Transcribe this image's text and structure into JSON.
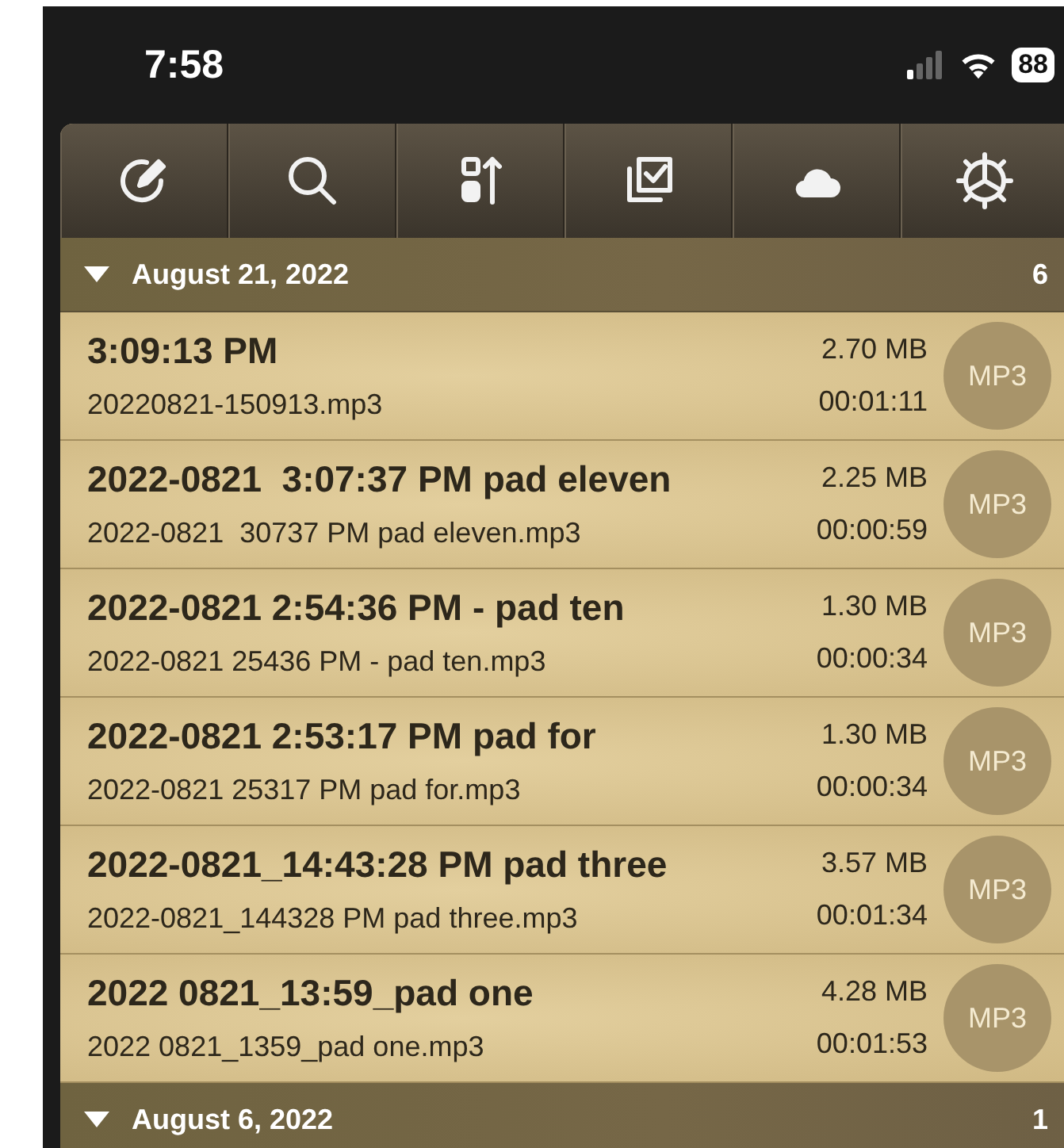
{
  "status_bar": {
    "time": "7:58",
    "battery": "88"
  },
  "toolbar": {
    "buttons": [
      {
        "kind": "edit"
      },
      {
        "kind": "search"
      },
      {
        "kind": "sort"
      },
      {
        "kind": "select"
      },
      {
        "kind": "cloud"
      },
      {
        "kind": "settings"
      }
    ]
  },
  "sections": [
    {
      "title": "August 21, 2022",
      "count": "6",
      "expanded": true,
      "items": [
        {
          "title": "3:09:13 PM",
          "file": "20220821-150913.mp3",
          "size": "2.70 MB",
          "duration": "00:01:11",
          "format": "MP3"
        },
        {
          "title": "2022-0821  3:07:37 PM pad eleven",
          "file": "2022-0821  30737 PM pad eleven.mp3",
          "size": "2.25 MB",
          "duration": "00:00:59",
          "format": "MP3"
        },
        {
          "title": "2022-0821 2:54:36 PM - pad ten",
          "file": "2022-0821 25436 PM - pad ten.mp3",
          "size": "1.30 MB",
          "duration": "00:00:34",
          "format": "MP3"
        },
        {
          "title": "2022-0821 2:53:17 PM pad for",
          "file": "2022-0821 25317 PM pad for.mp3",
          "size": "1.30 MB",
          "duration": "00:00:34",
          "format": "MP3"
        },
        {
          "title": "2022-0821_14:43:28 PM pad three",
          "file": "2022-0821_144328 PM pad three.mp3",
          "size": "3.57 MB",
          "duration": "00:01:34",
          "format": "MP3"
        },
        {
          "title": "2022 0821_13:59_pad one",
          "file": "2022 0821_1359_pad one.mp3",
          "size": "4.28 MB",
          "duration": "00:01:53",
          "format": "MP3"
        }
      ]
    },
    {
      "title": "August 6, 2022",
      "count": "1",
      "expanded": true
    }
  ]
}
